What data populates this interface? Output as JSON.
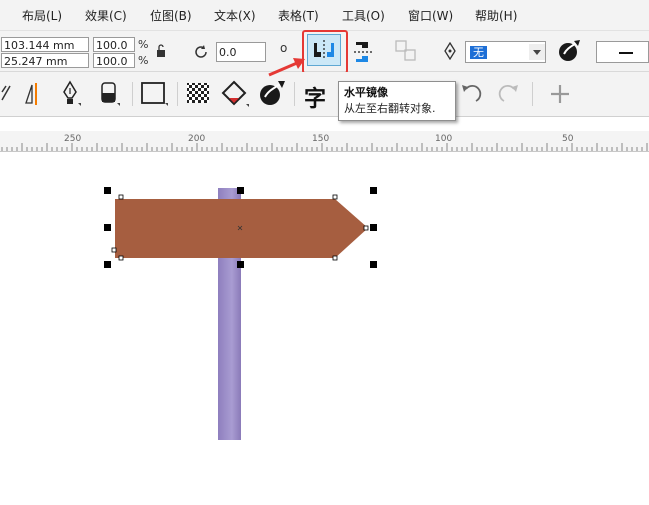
{
  "menu": {
    "items": [
      "布局(L)",
      "效果(C)",
      "位图(B)",
      "文本(X)",
      "表格(T)",
      "工具(O)",
      "窗口(W)",
      "帮助(H)"
    ]
  },
  "property_bar": {
    "width_value": "103.144 mm",
    "height_value": "25.247 mm",
    "scale_x": "100.0",
    "scale_y": "100.0",
    "pct_symbol": "%",
    "rotation_value": "0.0",
    "degree_symbol": "o",
    "outline_label": "无"
  },
  "tooltip": {
    "title": "水平镜像",
    "description": "从左至右翻转对象."
  },
  "toolbar2": {
    "text_tool_glyph": "字"
  },
  "ruler": {
    "labels": [
      "250",
      "200",
      "150",
      "100",
      "50"
    ]
  },
  "colors": {
    "accent_highlight": "#e53935",
    "selected_button_bg": "#cce8f7",
    "sign_fill": "#a65e40",
    "post_fill": "#9a8ac4"
  },
  "icons": [
    "undo-rotate-icon",
    "lock-ratio-icon",
    "mirror-horizontal-icon",
    "mirror-vertical-icon",
    "transform-icon",
    "pen-nib-icon",
    "dropdown-arrow-icon",
    "eyedropper-icon",
    "envelope-tool-icon",
    "perspective-icon",
    "pen-tool-icon",
    "eraser-icon",
    "rectangle-tool-icon",
    "checker-pattern-icon",
    "fill-tool-icon",
    "interactive-fill-icon",
    "text-tool-icon",
    "redo-icon",
    "add-icon"
  ]
}
